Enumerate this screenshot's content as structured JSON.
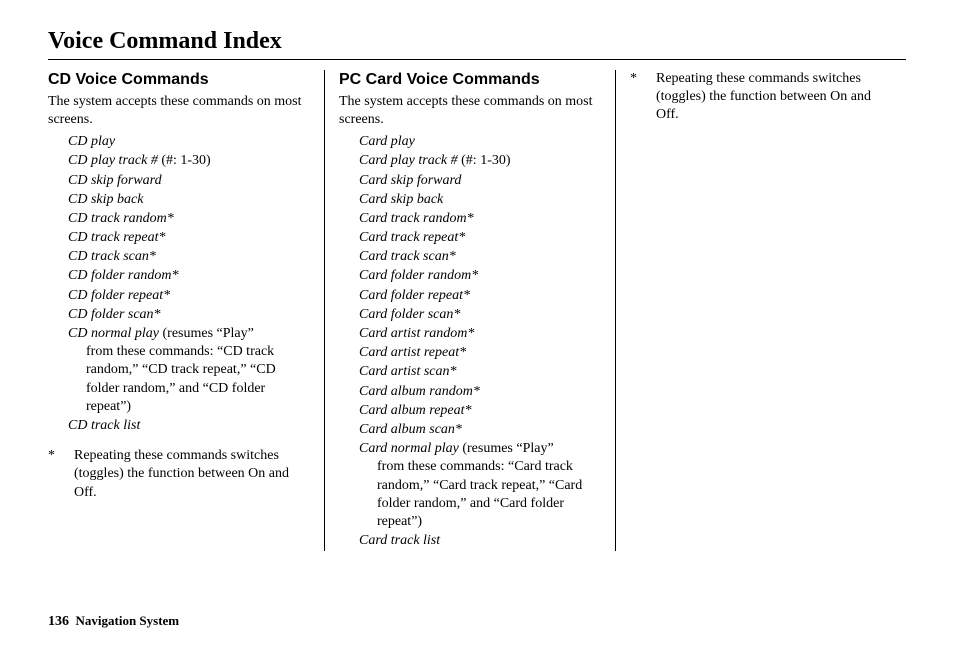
{
  "page_title": "Voice Command Index",
  "footer": {
    "page_number": "136",
    "section": "Navigation System"
  },
  "footnote": {
    "symbol": "*",
    "text": "Repeating these commands switches (toggles) the function between On and Off."
  },
  "col1": {
    "heading": "CD Voice Commands",
    "intro": "The system accepts these commands on most screens.",
    "commands": [
      {
        "text": "CD play"
      },
      {
        "text": "CD play track #",
        "note": " (#: 1-30)"
      },
      {
        "text": "CD skip forward"
      },
      {
        "text": "CD skip back"
      },
      {
        "text": "CD track random*"
      },
      {
        "text": "CD track repeat*"
      },
      {
        "text": "CD track scan*"
      },
      {
        "text": "CD folder random*"
      },
      {
        "text": "CD folder repeat*"
      },
      {
        "text": "CD folder scan*"
      },
      {
        "text": "CD normal play",
        "note": " (resumes “Play”",
        "sub": "from these commands: “CD track random,” “CD track repeat,” “CD folder random,” and “CD folder repeat”)"
      },
      {
        "text": "CD track list"
      }
    ]
  },
  "col2": {
    "heading": "PC Card Voice Commands",
    "intro": "The system accepts these commands on most screens.",
    "commands": [
      {
        "text": "Card play"
      },
      {
        "text": "Card play track #",
        "note": " (#: 1-30)"
      },
      {
        "text": "Card skip forward"
      },
      {
        "text": "Card skip back"
      },
      {
        "text": "Card track random*"
      },
      {
        "text": "Card track repeat*"
      },
      {
        "text": "Card track scan*"
      },
      {
        "text": "Card folder random*"
      },
      {
        "text": "Card folder repeat*"
      },
      {
        "text": "Card folder scan*"
      },
      {
        "text": "Card artist random*"
      },
      {
        "text": "Card artist repeat*"
      },
      {
        "text": "Card artist scan*"
      },
      {
        "text": "Card album random*"
      },
      {
        "text": "Card album repeat*"
      },
      {
        "text": "Card album scan*"
      },
      {
        "text": "Card normal play",
        "note": " (resumes “Play”",
        "sub": "from these commands: “Card track random,” “Card track repeat,” “Card folder random,” and “Card folder repeat”)"
      },
      {
        "text": "Card track list"
      }
    ]
  }
}
